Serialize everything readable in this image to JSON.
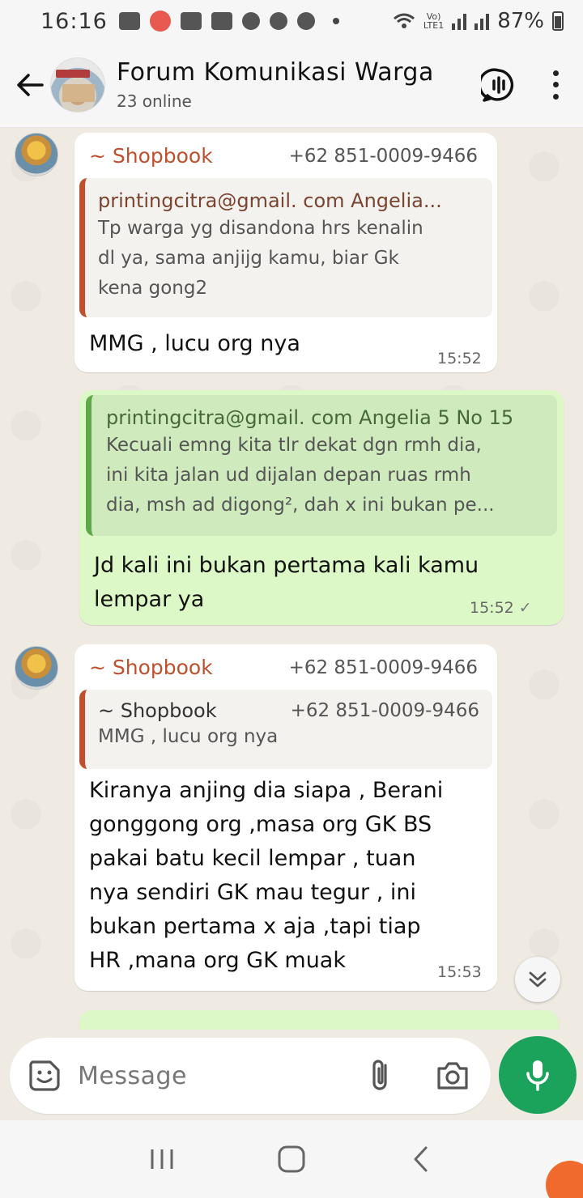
{
  "status_bar": {
    "time": "16:16",
    "battery": "87%",
    "network": "LTE1"
  },
  "header": {
    "title": "Forum Komunikasi Warga",
    "subtitle": "23 online",
    "avatar_label": "San Dona"
  },
  "messages": [
    {
      "sender": "~ Shopbook",
      "phone": "+62 851-0009-9466",
      "quote_author": "printingcitra@gmail. com Angelia...",
      "quote_lines": [
        "Tp warga yg disandona hrs kenalin",
        "dl ya, sama anjijg kamu, biar Gk",
        "kena gong2"
      ],
      "text": "MMG , lucu org nya",
      "time": "15:52"
    },
    {
      "quote_author": "printingcitra@gmail. com Angelia 5 No 15",
      "quote_lines": [
        "Kecuali emng kita tlr dekat dgn rmh dia,",
        "ini kita jalan ud dijalan depan ruas rmh",
        "dia, msh ad digong², dah x ini bukan pe..."
      ],
      "text_lines": [
        "Jd kali ini bukan pertama kali kamu",
        "lempar ya"
      ],
      "time": "15:52",
      "check": "✓"
    },
    {
      "sender": "~ Shopbook",
      "phone": "+62 851-0009-9466",
      "quote_author": "~ Shopbook",
      "quote_phone": "+62 851-0009-9466",
      "quote_lines": [
        "MMG , lucu org nya"
      ],
      "text_lines": [
        "Kiranya anjing dia siapa , Berani",
        "gonggong org ,masa org GK BS",
        "pakai batu kecil lempar , tuan",
        "nya sendiri GK mau tegur , ini",
        "bukan pertama x aja ,tapi tiap",
        "HR ,mana org GK muak"
      ],
      "time": "15:53"
    }
  ],
  "input": {
    "placeholder": "Message"
  },
  "colors": {
    "accent": "#1ba35c",
    "sender_name": "#c0502b",
    "outgoing_bubble": "#dcf8c6",
    "chat_background": "#efeae2"
  },
  "icons": [
    "back-arrow-icon",
    "group-call-icon",
    "more-options-icon",
    "scroll-down-icon",
    "emoji-icon",
    "attach-icon",
    "camera-icon",
    "mic-icon",
    "recents-icon",
    "home-icon",
    "nav-back-icon"
  ]
}
